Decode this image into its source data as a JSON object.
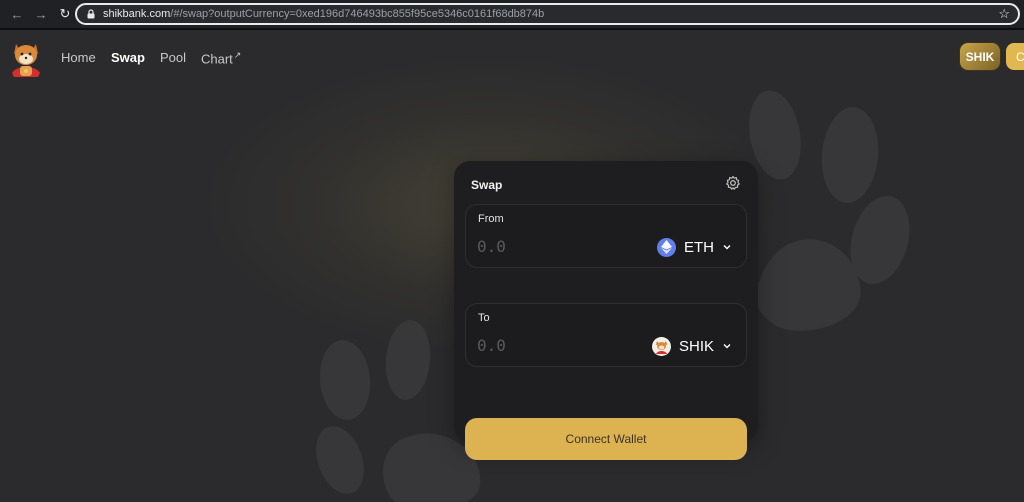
{
  "browser": {
    "url_host": "shikbank.com",
    "url_path": "/#/swap?outputCurrency=0xed196d746493bc855f95ce5346c0161f68db874b"
  },
  "header": {
    "nav": [
      {
        "label": "Home"
      },
      {
        "label": "Swap"
      },
      {
        "label": "Pool"
      },
      {
        "label": "Chart"
      }
    ],
    "shik_badge": "SHIK",
    "connect_partial": "C"
  },
  "swap": {
    "title": "Swap",
    "from": {
      "label": "From",
      "placeholder": "0.0",
      "token": "ETH",
      "token_icon": "ethereum-icon"
    },
    "to": {
      "label": "To",
      "placeholder": "0.0",
      "token": "SHIK",
      "token_icon": "shik-dog-icon"
    },
    "connect_label": "Connect Wallet"
  },
  "colors": {
    "background": "#2b2b2d",
    "card": "#1e1e20",
    "accent_gold": "#ddb352",
    "eth_blue": "#627eea"
  }
}
